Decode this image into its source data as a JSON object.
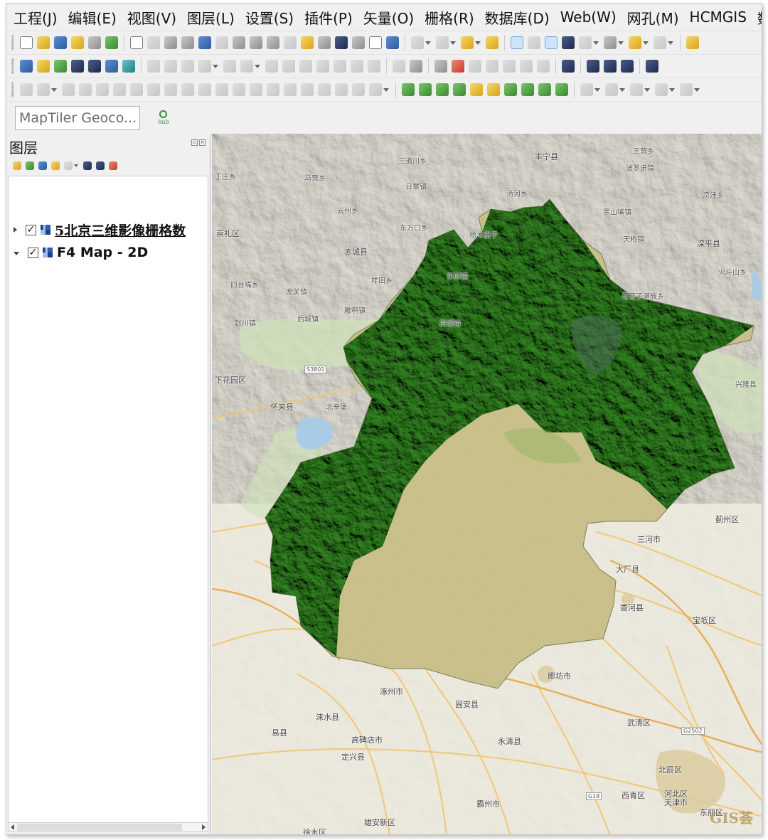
{
  "menu": [
    "工程(J)",
    "编辑(E)",
    "视图(V)",
    "图层(L)",
    "设置(S)",
    "插件(P)",
    "矢量(O)",
    "栅格(R)",
    "数据库(D)",
    "Web(W)",
    "网孔(M)",
    "HCMGIS",
    "数据"
  ],
  "geocoder": {
    "placeholder": "MapTiler Geoco...",
    "hub_label": "hub"
  },
  "layers_panel": {
    "title": "图层",
    "layers": [
      {
        "name": "5北京三维影像栅格数",
        "checked": true,
        "expanded": false
      },
      {
        "name": "F4 Map - 2D",
        "checked": true,
        "expanded": true
      }
    ]
  },
  "map": {
    "places": [
      "丰宁县",
      "三道川乡",
      "王营乡",
      "丁庄乡",
      "涝洼乡",
      "马营乡",
      "日寨镇",
      "汤河乡",
      "波罗诺镇",
      "云州乡",
      "后城镇",
      "黑山嘴镇",
      "崇礼区",
      "东万口乡",
      "赤城县",
      "杨木栅子",
      "天桥镇",
      "滦平县",
      "四台嘴乡",
      "样田乡",
      "龙关镇",
      "东卯镇",
      "火斗山乡",
      "雕鹗镇",
      "马营子满族乡",
      "赵川镇",
      "后城镇",
      "下花园区",
      "怀来县",
      "北辛堡",
      "兴隆县",
      "蓟州区",
      "三河市",
      "大厂县",
      "香河县",
      "宝坻区",
      "涿州市",
      "固安县",
      "廊坊市",
      "涞水县",
      "易县",
      "高碑店市",
      "永清县",
      "武清区",
      "定兴县",
      "北辰区",
      "西青区",
      "河北区",
      "天津市",
      "雄安新区",
      "霸州市",
      "徐水区",
      "东丽区"
    ],
    "road_shields": [
      "S3801",
      "G18",
      "G2502"
    ],
    "watermark": "GIS荟"
  },
  "colors": {
    "forest": "#2f7a1f",
    "plain": "#cdbf8e",
    "road": "#f2c46b",
    "water": "#a9cbe6"
  }
}
